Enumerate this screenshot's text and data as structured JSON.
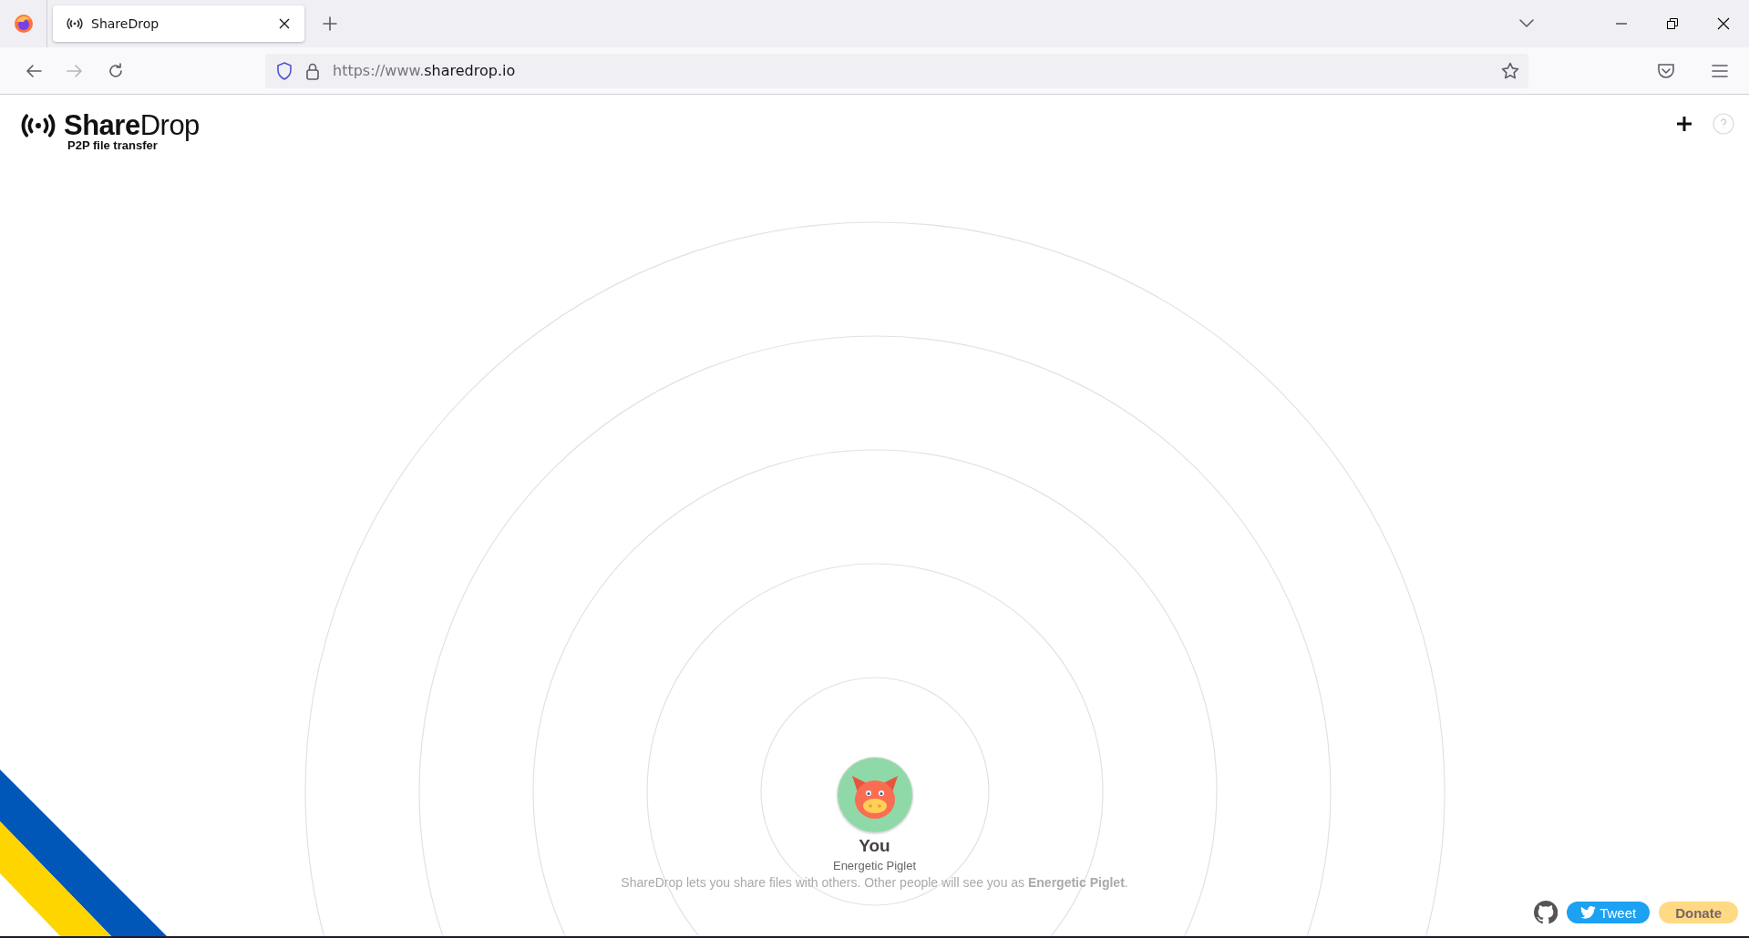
{
  "browser": {
    "tabs": [
      {
        "title": "ShareDrop",
        "selected": true
      }
    ],
    "url": {
      "scheme": "https://www.",
      "domain": "sharedrop.io"
    }
  },
  "page": {
    "logo": {
      "bold": "Share",
      "light": "Drop",
      "tagline": "P2P file transfer"
    },
    "user": {
      "label": "You",
      "name": "Energetic Piglet"
    },
    "intro": "ShareDrop lets you share files with others. Other people will see you as **Energetic Piglet**.",
    "footer": {
      "tweet": "Tweet",
      "donate": "Donate"
    }
  }
}
